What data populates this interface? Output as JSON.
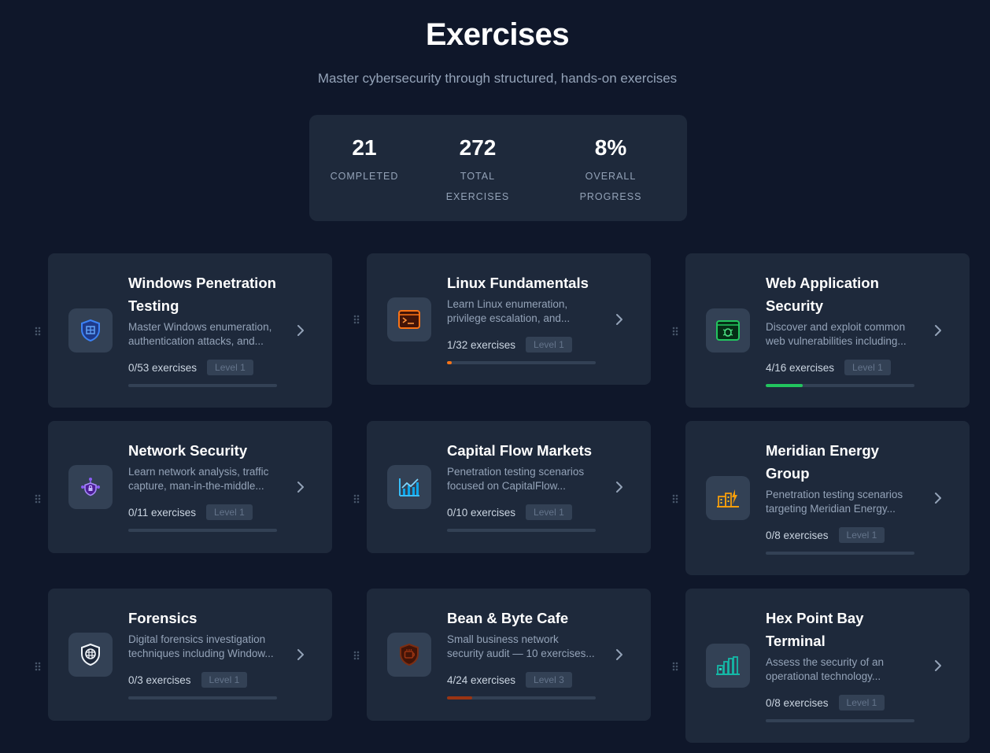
{
  "header": {
    "title": "Exercises",
    "subtitle": "Master cybersecurity through structured, hands-on exercises"
  },
  "stats": [
    {
      "value": "21",
      "label_line1": "COMPLETED",
      "label_line2": ""
    },
    {
      "value": "272",
      "label_line1": "TOTAL",
      "label_line2": "EXERCISES"
    },
    {
      "value": "8%",
      "label_line1": "OVERALL",
      "label_line2": "PROGRESS"
    }
  ],
  "cards": [
    {
      "title_line1": "Windows Penetration",
      "title_line2": "Testing",
      "desc_line1": "Master Windows enumeration,",
      "desc_line2": "authentication attacks, and...",
      "count": "0/53 exercises",
      "level": "Level 1",
      "progress": 0,
      "accent": "#3b82f6",
      "icon": "shield-icon"
    },
    {
      "title_line1": "Linux Fundamentals",
      "title_line2": "",
      "desc_line1": "Learn Linux enumeration,",
      "desc_line2": "privilege escalation, and...",
      "count": "1/32 exercises",
      "level": "Level 1",
      "progress": 0.03,
      "accent": "#f97316",
      "icon": "terminal-icon"
    },
    {
      "title_line1": "Web Application",
      "title_line2": "Security",
      "desc_line1": "Discover and exploit common",
      "desc_line2": "web vulnerabilities including...",
      "count": "4/16 exercises",
      "level": "Level 1",
      "progress": 0.25,
      "accent": "#22c55e",
      "icon": "bug-browser-icon"
    },
    {
      "title_line1": "Network Security",
      "title_line2": "",
      "desc_line1": "Learn network analysis, traffic",
      "desc_line2": "capture, man-in-the-middle...",
      "count": "0/11 exercises",
      "level": "Level 1",
      "progress": 0,
      "accent": "#8b5cf6",
      "icon": "network-lock-icon"
    },
    {
      "title_line1": "Capital Flow Markets",
      "title_line2": "",
      "desc_line1": "Penetration testing scenarios",
      "desc_line2": "focused on CapitalFlow...",
      "count": "0/10 exercises",
      "level": "Level 1",
      "progress": 0,
      "accent": "#38bdf8",
      "icon": "chart-icon"
    },
    {
      "title_line1": "Meridian Energy",
      "title_line2": "Group",
      "desc_line1": "Penetration testing scenarios",
      "desc_line2": "targeting Meridian Energy...",
      "count": "0/8 exercises",
      "level": "Level 1",
      "progress": 0,
      "accent": "#f59e0b",
      "icon": "power-plant-icon"
    },
    {
      "title_line1": "Forensics",
      "title_line2": "",
      "desc_line1": "Digital forensics investigation",
      "desc_line2": "techniques including Window...",
      "count": "0/3 exercises",
      "level": "Level 1",
      "progress": 0,
      "accent": "#e2e8f0",
      "icon": "forensics-shield-icon"
    },
    {
      "title_line1": "Bean & Byte Cafe",
      "title_line2": "",
      "desc_line1": "Small business network",
      "desc_line2": "security audit — 10 exercises...",
      "count": "4/24 exercises",
      "level": "Level 3",
      "progress": 0.17,
      "accent": "#9a3412",
      "icon": "coffee-shield-icon"
    },
    {
      "title_line1": "Hex Point Bay",
      "title_line2": "Terminal",
      "desc_line1": "Assess the security of an",
      "desc_line2": "operational technology...",
      "count": "0/8 exercises",
      "level": "Level 1",
      "progress": 0,
      "accent": "#14b8a6",
      "icon": "industrial-icon"
    }
  ]
}
